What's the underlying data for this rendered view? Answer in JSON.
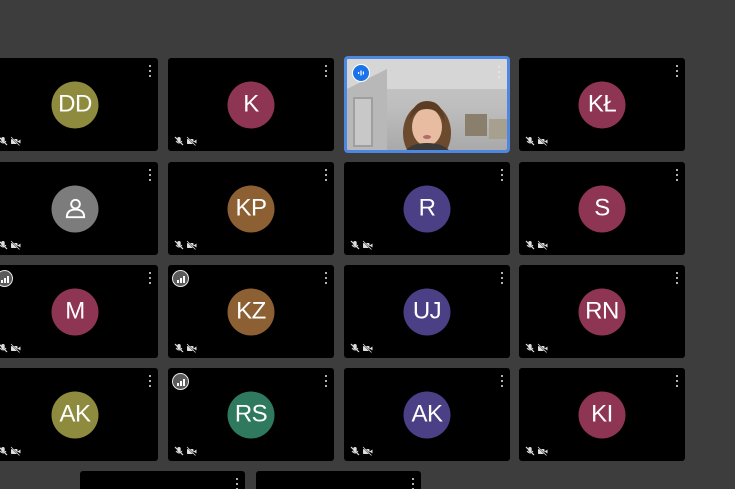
{
  "meeting": {
    "tiles": [
      {
        "initials": "DD",
        "color": "#8e8b3e",
        "signal": false
      },
      {
        "initials": "K",
        "color": "#8e3553",
        "signal": false
      },
      {
        "initials": "",
        "video": true,
        "speaking": true
      },
      {
        "initials": "KŁ",
        "color": "#8e3553",
        "signal": false
      },
      {
        "initials": "",
        "icon": "person-icon",
        "color": "#7c7c7c",
        "signal": false
      },
      {
        "initials": "KP",
        "color": "#8d6034",
        "signal": false
      },
      {
        "initials": "R",
        "color": "#4b3f86",
        "signal": false
      },
      {
        "initials": "S",
        "color": "#8e3553",
        "signal": false
      },
      {
        "initials": "M",
        "color": "#8e3553",
        "signal": true
      },
      {
        "initials": "KZ",
        "color": "#8d6034",
        "signal": true
      },
      {
        "initials": "UJ",
        "color": "#4b3f86",
        "signal": false
      },
      {
        "initials": "RN",
        "color": "#8e3553",
        "signal": false
      },
      {
        "initials": "AK",
        "color": "#8e8b3e",
        "signal": false
      },
      {
        "initials": "RS",
        "color": "#2f7a5f",
        "signal": true
      },
      {
        "initials": "AK",
        "color": "#4b3f86",
        "signal": false
      },
      {
        "initials": "KI",
        "color": "#8e3553",
        "signal": false
      }
    ]
  }
}
